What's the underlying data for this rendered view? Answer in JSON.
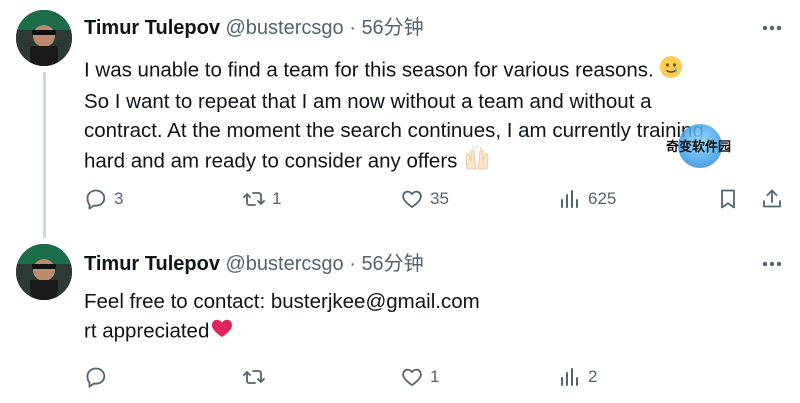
{
  "tweets": [
    {
      "name": "Timur Tulepov",
      "handle": "@bustercsgo",
      "separator": "·",
      "time": "56分钟",
      "lines": [
        "I was unable to find a team for this season for various reasons.",
        "So I want to repeat that I am now without a team and without a",
        "contract. At the moment the search continues, I am currently training",
        "hard and am ready to consider any offers"
      ],
      "emoji_names": [
        "face-with-tear-emoji",
        "raised-hands-emoji"
      ],
      "replies": "3",
      "retweets": "1",
      "likes": "35",
      "views": "625"
    },
    {
      "name": "Timur Tulepov",
      "handle": "@bustercsgo",
      "separator": "·",
      "time": "56分钟",
      "lines": [
        "Feel free to contact: busterjkee@gmail.com",
        "rt appreciated"
      ],
      "emoji_names": [
        "red-heart-emoji"
      ],
      "replies": "",
      "retweets": "",
      "likes": "1",
      "views": "2"
    }
  ],
  "watermark": {
    "text": "奇变软件园"
  },
  "colors": {
    "text": "#0f1419",
    "secondary": "#536471",
    "thread_line": "#cfd9de",
    "heart": "#e0245e"
  }
}
